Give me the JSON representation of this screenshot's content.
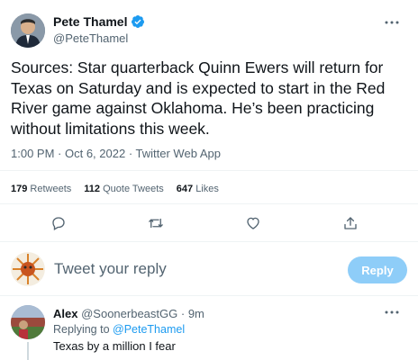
{
  "colors": {
    "accent": "#1d9bf0",
    "reply_button_bg": "#8ecdf8",
    "text": "#0f1419",
    "muted": "#536471"
  },
  "tweet": {
    "author_name": "Pete Thamel",
    "author_handle": "@PeteThamel",
    "verified_icon": "verified-badge-icon",
    "more_icon": "more-horizontal-icon",
    "text": "Sources: Star quarterback Quinn Ewers will return for Texas on Saturday and is expected to start in the Red River game against Oklahoma. He’s been practicing without limitations this week.",
    "meta": {
      "time": "1:00 PM",
      "sep1": " · ",
      "date": "Oct 6, 2022",
      "sep2": " · ",
      "source": "Twitter Web App"
    },
    "stats": {
      "retweets_count": "179",
      "retweets_label": "Retweets",
      "quotes_count": "112",
      "quotes_label": "Quote Tweets",
      "likes_count": "647",
      "likes_label": "Likes"
    },
    "actions": [
      "reply-icon",
      "retweet-icon",
      "like-icon",
      "share-icon"
    ]
  },
  "composer": {
    "placeholder": "Tweet your reply",
    "button_label": "Reply"
  },
  "reply": {
    "author_name": "Alex",
    "author_handle": "@SoonerbeastGG",
    "sep": " · ",
    "time": "9m",
    "replying_prefix": "Replying to ",
    "replying_to": "@PeteThamel",
    "text": "Texas by a million I fear"
  }
}
